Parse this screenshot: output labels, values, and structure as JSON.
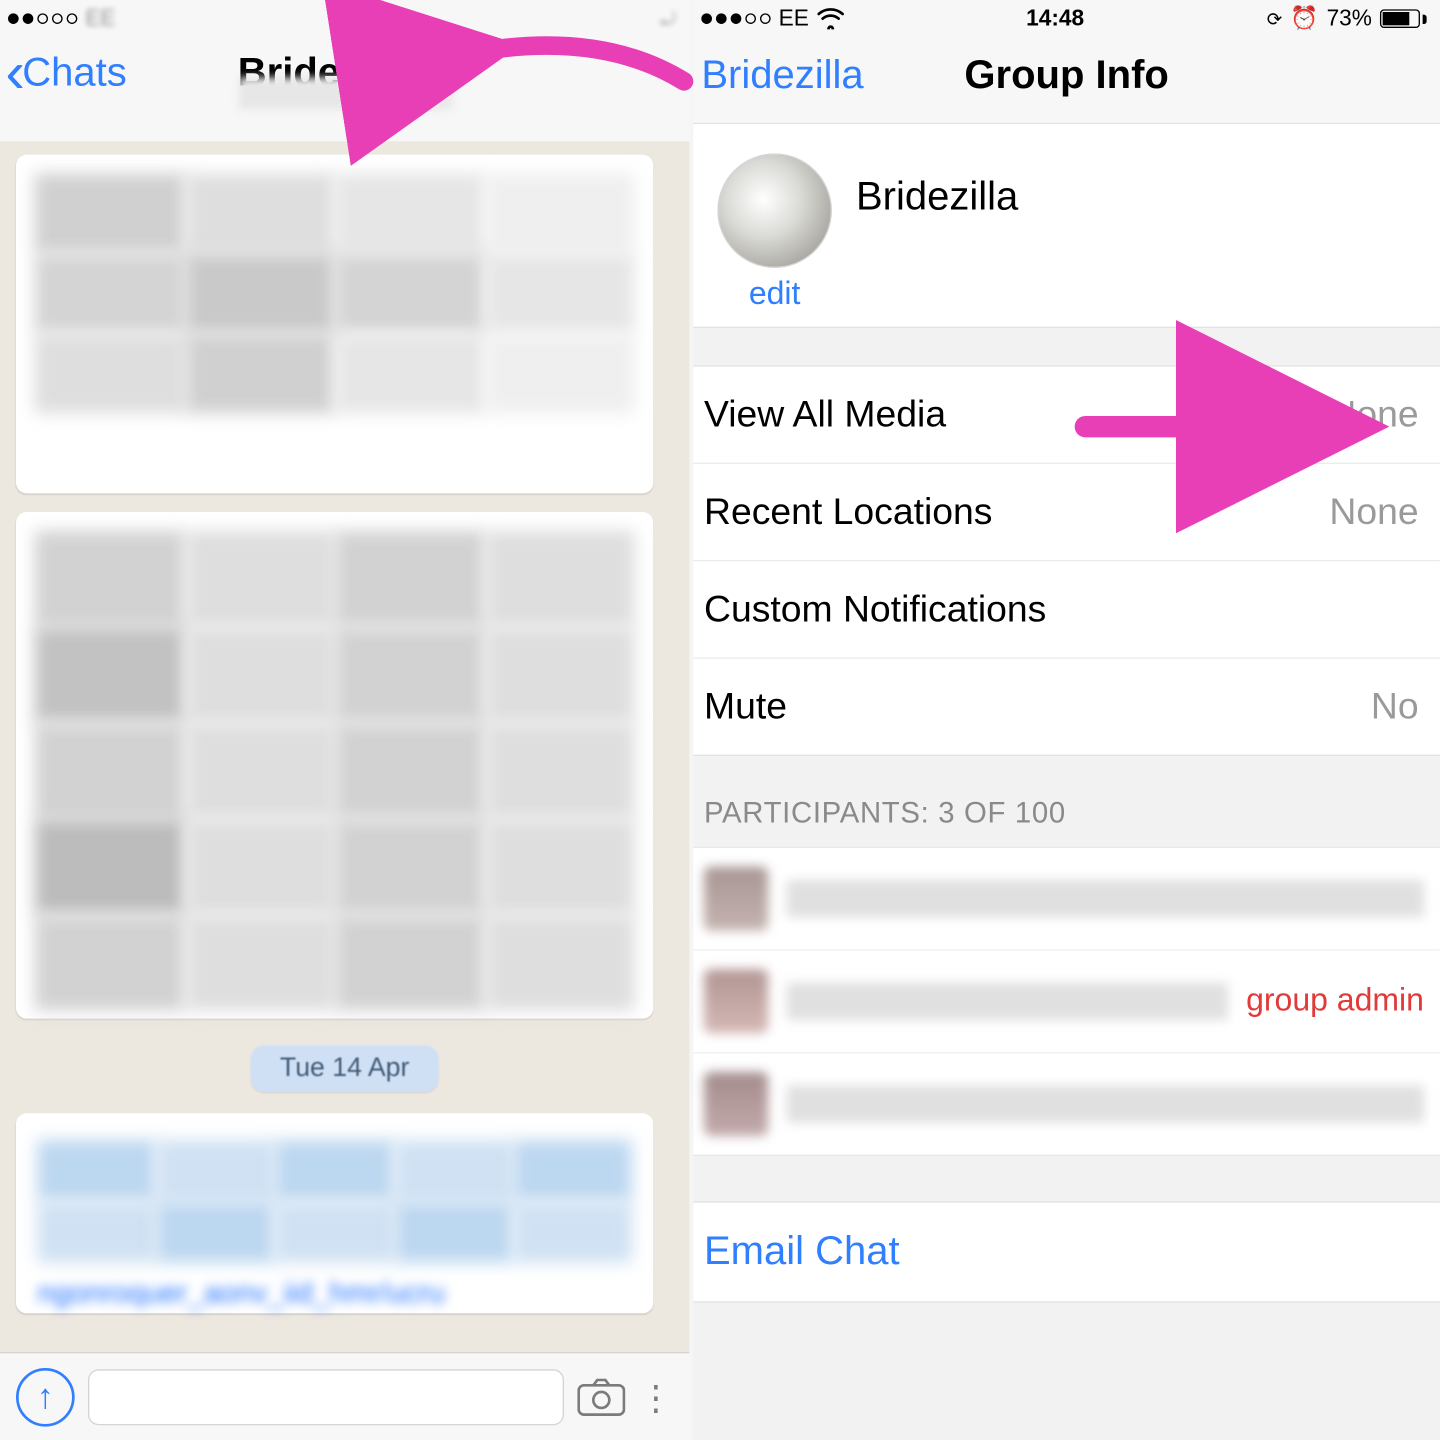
{
  "left_panel": {
    "statusbar": {
      "carrier": "EE"
    },
    "navbar": {
      "back_label": "Chats",
      "title": "Bridezilla"
    },
    "date_pill": "Tue 14 Apr",
    "link_text": "ngonroquer_aonv_iid_hmr/ucru"
  },
  "right_panel": {
    "statusbar": {
      "carrier": "EE",
      "time": "14:48",
      "battery_pct": "73%"
    },
    "navbar": {
      "back_label": "Bridezilla",
      "title": "Group Info"
    },
    "group": {
      "name": "Bridezilla",
      "edit_label": "edit"
    },
    "settings": {
      "view_media_label": "View All Media",
      "view_media_value": "None",
      "recent_loc_label": "Recent Locations",
      "recent_loc_value": "None",
      "custom_notif_label": "Custom Notifications",
      "mute_label": "Mute",
      "mute_value": "No"
    },
    "participants_header": "PARTICIPANTS: 3 OF 100",
    "participants": {
      "admin_label": "group admin"
    },
    "email_chat": "Email Chat"
  },
  "annotation": {
    "color": "#e83fb7"
  }
}
